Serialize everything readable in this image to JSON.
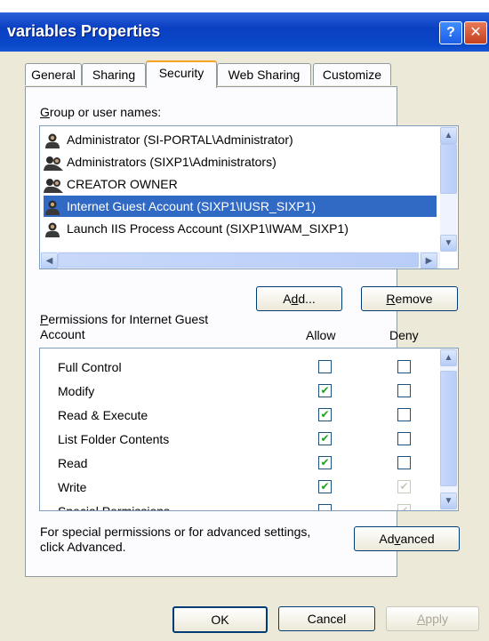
{
  "window": {
    "title": "variables Properties",
    "help_glyph": "?",
    "close_glyph": "✕"
  },
  "tabs": [
    "General",
    "Sharing",
    "Security",
    "Web Sharing",
    "Customize"
  ],
  "active_tab": "Security",
  "group_label": {
    "accel": "G",
    "rest": "roup or user names:"
  },
  "users": [
    {
      "name": "Administrator (SI-PORTAL\\Administrator)",
      "icon": "user-icon",
      "selected": false
    },
    {
      "name": "Administrators (SIXP1\\Administrators)",
      "icon": "group-icon",
      "selected": false
    },
    {
      "name": "CREATOR OWNER",
      "icon": "group-icon",
      "selected": false
    },
    {
      "name": "Internet Guest Account (SIXP1\\IUSR_SIXP1)",
      "icon": "user-icon",
      "selected": true
    },
    {
      "name": "Launch IIS Process Account (SIXP1\\IWAM_SIXP1)",
      "icon": "user-icon",
      "selected": false
    }
  ],
  "buttons": {
    "add": {
      "pre": "A",
      "accel": "d",
      "post": "d..."
    },
    "remove": {
      "accel": "R",
      "post": "emove"
    },
    "advanced": {
      "pre": "Ad",
      "accel": "v",
      "post": "anced"
    },
    "ok": "OK",
    "cancel": "Cancel",
    "apply": {
      "accel": "A",
      "post": "pply"
    }
  },
  "permissions_label": {
    "accel": "P",
    "line1": "ermissions for Internet Guest",
    "line2": "Account"
  },
  "col_allow": "Allow",
  "col_deny": "Deny",
  "permissions": [
    {
      "name": "Full Control",
      "allow": false,
      "deny": false,
      "deny_disabled": false
    },
    {
      "name": "Modify",
      "allow": true,
      "deny": false,
      "deny_disabled": false
    },
    {
      "name": "Read & Execute",
      "allow": true,
      "deny": false,
      "deny_disabled": false
    },
    {
      "name": "List Folder Contents",
      "allow": true,
      "deny": false,
      "deny_disabled": false
    },
    {
      "name": "Read",
      "allow": true,
      "deny": false,
      "deny_disabled": false
    },
    {
      "name": "Write",
      "allow": true,
      "deny": true,
      "deny_disabled": true
    },
    {
      "name": "Special Permissions",
      "allow": false,
      "deny": true,
      "deny_disabled": true
    }
  ],
  "advanced_text": {
    "line1": "For special permissions or for advanced settings,",
    "line2": "click Advanced."
  },
  "scroll_glyphs": {
    "up": "▲",
    "down": "▼",
    "left": "◀",
    "right": "▶",
    "grip": "≡"
  }
}
